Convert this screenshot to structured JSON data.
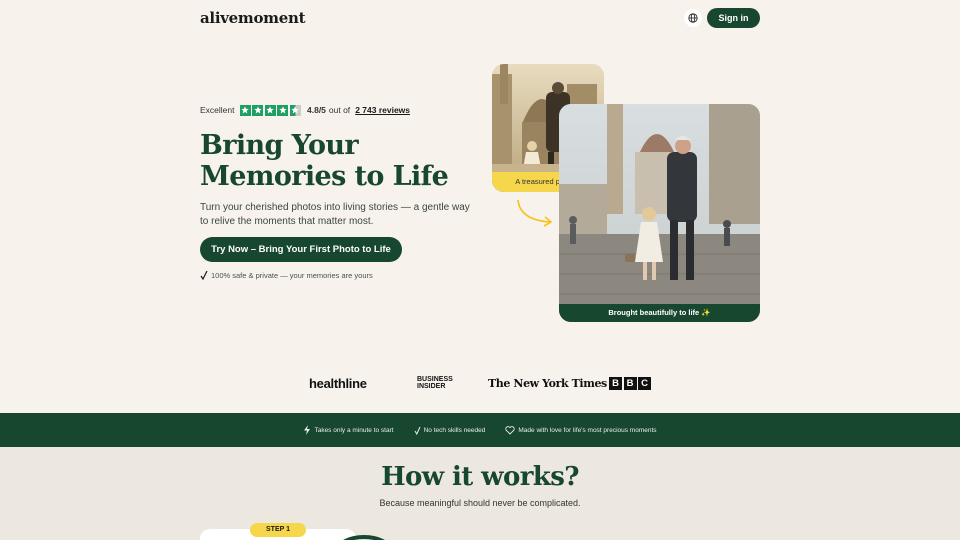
{
  "header": {
    "logo": "alivemoment",
    "globe_icon": "globe-icon",
    "signin_label": "Sign in"
  },
  "hero": {
    "rating": {
      "label": "Excellent",
      "score": "4.8/5",
      "out_of": "out of",
      "reviews": "2 743 reviews",
      "stars": 4.5
    },
    "title_line1": "Bring Your",
    "title_line2": "Memories to Life",
    "subtitle": "Turn your cherished photos into living stories — a gentle way to relive the moments that matter most.",
    "cta_label": "Try Now – Bring Your First Photo to Life",
    "safe_note": "100% safe & private — your memories are yours",
    "old_photo_label": "A treasured photo...",
    "new_photo_label": "Brought beautifully to life ✨"
  },
  "press": {
    "healthline": "healthline",
    "business_insider_1": "BUSINESS",
    "business_insider_2": "INSIDER",
    "nyt": "The New York Times",
    "bbc": [
      "B",
      "B",
      "C"
    ]
  },
  "features": [
    {
      "icon": "lightning-icon",
      "label": "Takes only a minute to start"
    },
    {
      "icon": "check-icon",
      "label": "No tech skills needed"
    },
    {
      "icon": "heart-icon",
      "label": "Made with love for life's most precious moments"
    }
  ],
  "how_it_works": {
    "title": "How it works?",
    "subtitle": "Because meaningful should never be complicated.",
    "step_label": "STEP 1"
  },
  "colors": {
    "brand_green": "#18472f",
    "accent_yellow": "#f6d64a",
    "trust_green": "#1f9f64",
    "background": "#f7f3ec"
  }
}
